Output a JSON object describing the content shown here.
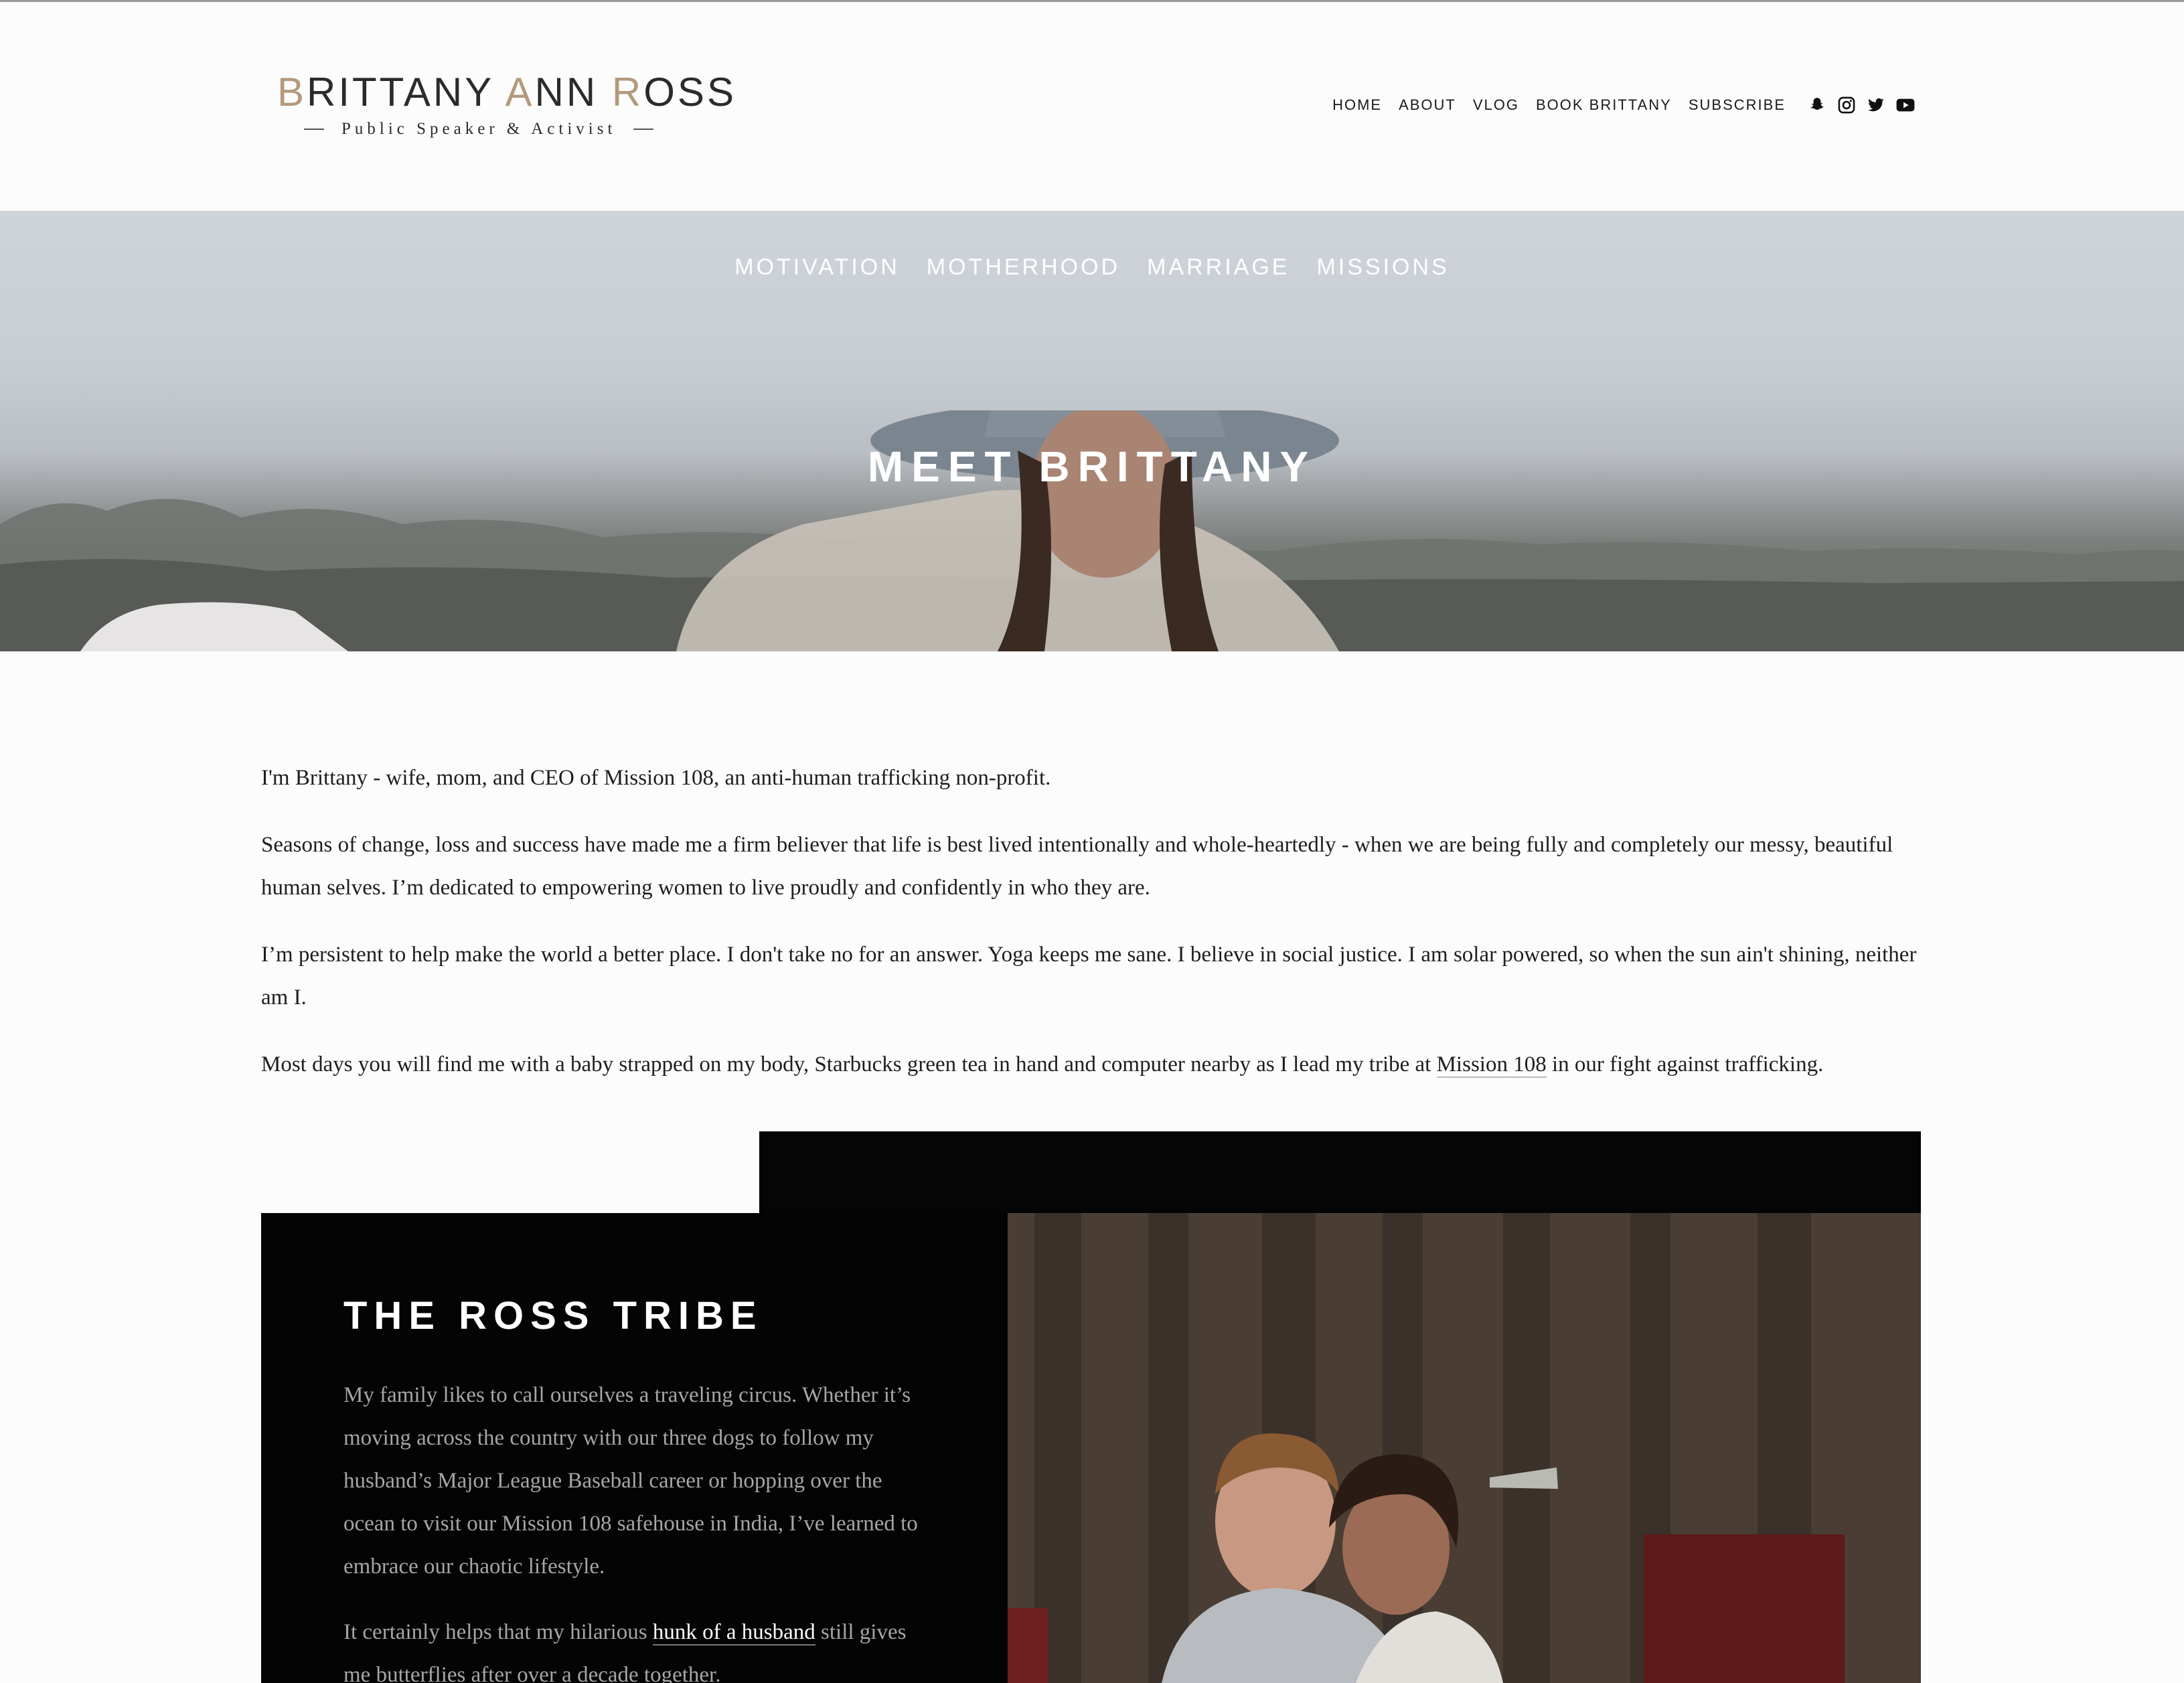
{
  "logo": {
    "name_parts": [
      "B",
      "RITTANY ",
      "A",
      "NN ",
      "R",
      "OSS"
    ],
    "tagline": "Public Speaker & Activist"
  },
  "nav": {
    "items": [
      "HOME",
      "ABOUT",
      "VLOG",
      "BOOK BRITTANY",
      "SUBSCRIBE"
    ],
    "social_icons": [
      "snapchat-icon",
      "instagram-icon",
      "twitter-icon",
      "youtube-icon"
    ]
  },
  "hero": {
    "sub_nav": [
      "MOTIVATION",
      "MOTHERHOOD",
      "MARRIAGE",
      "MISSIONS"
    ],
    "title": "MEET BRITTANY"
  },
  "intro": {
    "p1": "I'm Brittany - wife, mom, and CEO of Mission 108, an anti-human trafficking non-profit.",
    "p2": "Seasons of change, loss and success have made me a firm believer that life is best lived intentionally and whole-heartedly - when we are being fully and completely our messy, beautiful human selves. I’m dedicated to empowering women to live proudly and confidently in who they are.",
    "p3": "I’m persistent to help make the world a better place. I don't take no for an answer. Yoga keeps me sane. I believe in social justice. I am solar powered, so when the sun ain't shining, neither am I.",
    "p4_before": "Most days you will find me with a baby strapped on my body, Starbucks green tea in hand and computer nearby as I lead my tribe at ",
    "p4_link": "Mission 108",
    "p4_after": " in our fight against trafficking."
  },
  "tribe": {
    "title": "THE ROSS TRIBE",
    "p1": "My family likes to call ourselves a traveling circus. Whether it’s moving across the country with our three dogs to follow my husband’s Major League Baseball career or hopping over the ocean to visit our Mission 108 safehouse in India, I’ve learned to embrace our chaotic lifestyle.",
    "p2_before": "It certainly helps that my hilarious ",
    "p2_link": "hunk of a husband",
    "p2_after": " still gives me butterflies after over a decade together."
  },
  "colors": {
    "logo_accent": "#b39a7c",
    "background": "#fcfcfc",
    "tribe_card": "#040404",
    "tribe_text": "#a6a6a6"
  }
}
